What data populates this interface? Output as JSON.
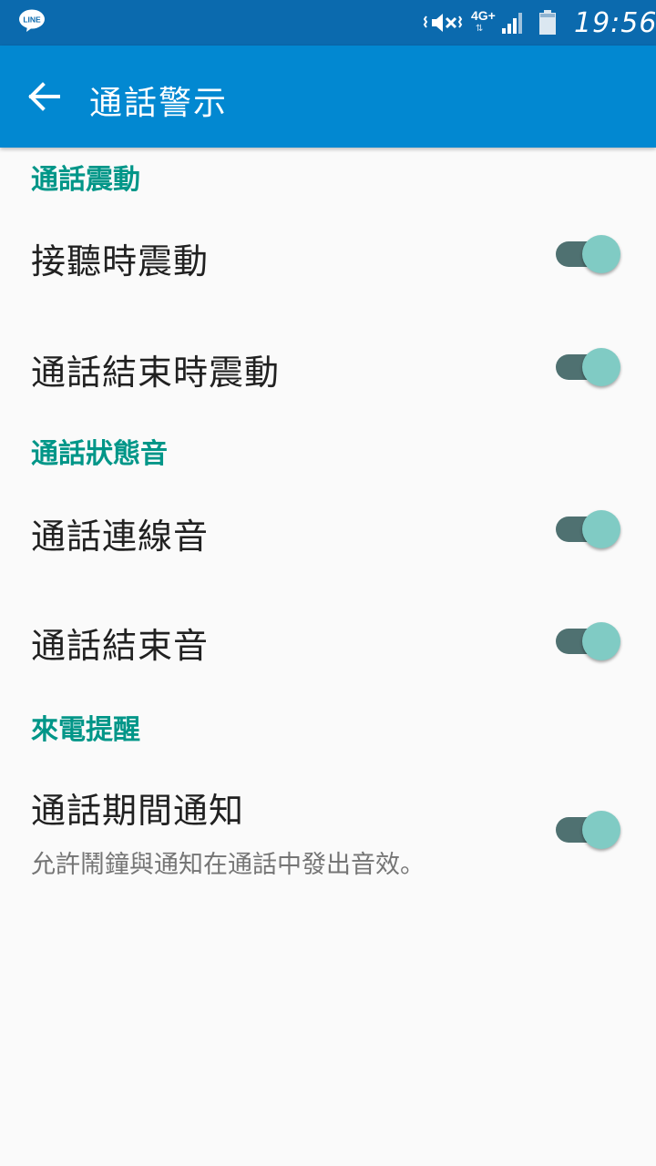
{
  "status_bar": {
    "app_icon_label": "LINE",
    "network": "4G+",
    "time": "19:56"
  },
  "app_bar": {
    "title": "通話警示"
  },
  "sections": [
    {
      "header": "通話震動",
      "items": [
        {
          "title": "接聽時震動",
          "enabled": true
        },
        {
          "title": "通話結束時震動",
          "enabled": true
        }
      ]
    },
    {
      "header": "通話狀態音",
      "items": [
        {
          "title": "通話連線音",
          "enabled": true
        },
        {
          "title": "通話結束音",
          "enabled": true
        }
      ]
    },
    {
      "header": "來電提醒",
      "items": [
        {
          "title": "通話期間通知",
          "summary": "允許鬧鐘與通知在通話中發出音效。",
          "enabled": true
        }
      ]
    }
  ],
  "colors": {
    "status_bar": "#0b6aae",
    "app_bar": "#0288d1",
    "section_header": "#009688",
    "switch_track": "#4f7171",
    "switch_thumb": "#80cbc4"
  }
}
